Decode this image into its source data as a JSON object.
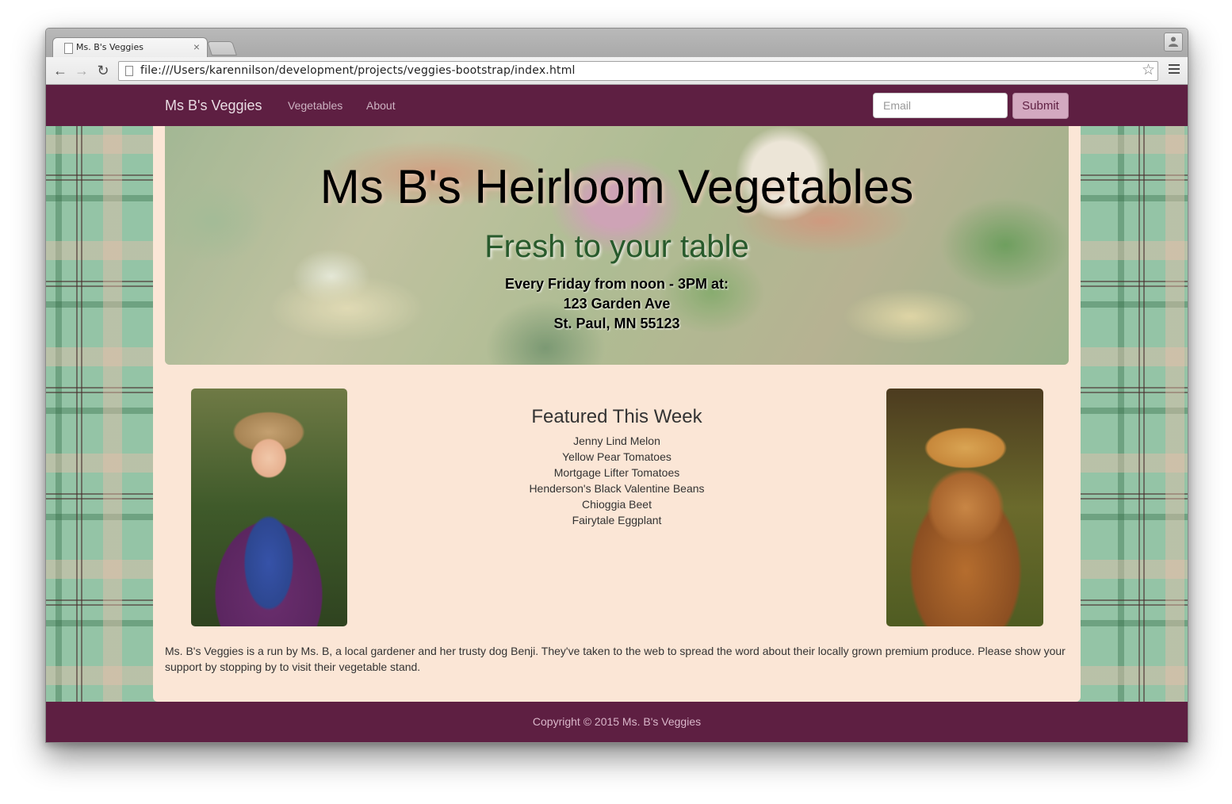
{
  "browser": {
    "tab_title": "Ms. B's Veggies",
    "tab_close": "×",
    "url": "file:///Users/karennilson/development/projects/veggies-bootstrap/index.html",
    "back_icon": "←",
    "forward_icon": "→",
    "reload_icon": "↻",
    "star_icon": "☆"
  },
  "navbar": {
    "brand": "Ms B's Veggies",
    "links": [
      "Vegetables",
      "About"
    ],
    "email_placeholder": "Email",
    "submit_label": "Submit"
  },
  "jumbotron": {
    "title": "Ms B's Heirloom Vegetables",
    "subtitle": "Fresh to your table",
    "lines": [
      "Every Friday from noon - 3PM at:",
      "123 Garden Ave",
      "St. Paul, MN 55123"
    ]
  },
  "featured": {
    "title": "Featured This Week",
    "items": [
      "Jenny Lind Melon",
      "Yellow Pear Tomatoes",
      "Mortgage Lifter Tomatoes",
      "Henderson's Black Valentine Beans",
      "Chioggia Beet",
      "Fairytale Eggplant"
    ]
  },
  "about": "Ms. B's Veggies is a run by Ms. B, a local gardener and her trusty dog Benji. They've taken to the web to spread the word about their locally grown premium produce. Please show your support by stopping by to visit their vegetable stand.",
  "footer": "Copyright © 2015 Ms. B's Veggies",
  "colors": {
    "navbar": "#5e1f42",
    "container": "#fbe6d6",
    "subtitle": "#285a2c",
    "submit": "#d3a9c0"
  }
}
